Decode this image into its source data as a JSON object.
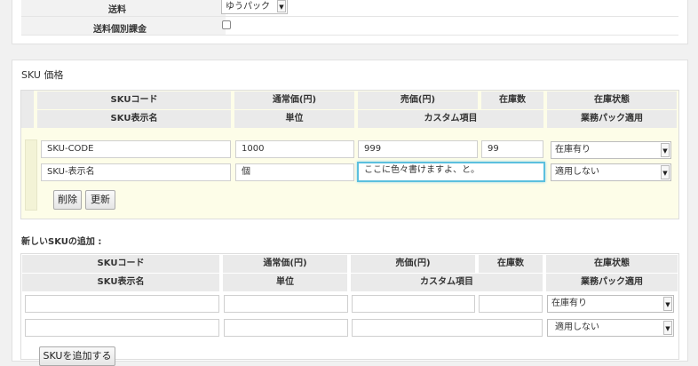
{
  "shipping": {
    "fee_label": "送料",
    "fee_select": "ゆうパック",
    "individual_label": "送料個別課金"
  },
  "sku_price": {
    "title": "SKU 価格",
    "headers_row1": [
      "SKUコード",
      "通常価(円)",
      "売価(円)",
      "在庫数",
      "在庫状態"
    ],
    "headers_row2": [
      "SKU表示名",
      "単位",
      "カスタム項目",
      "業務パック適用"
    ],
    "row": {
      "code": "SKU-CODE",
      "regular_price": "1000",
      "sale_price": "999",
      "stock": "99",
      "stock_status": "在庫有り",
      "display_name": "SKU-表示名",
      "unit": "個",
      "custom": "ここに色々書けますよ、と。",
      "pack": "適用しない"
    },
    "delete_button": "削除",
    "update_button": "更新"
  },
  "new_sku": {
    "title": "新しいSKUの追加 :",
    "headers_row1": [
      "SKUコード",
      "通常価(円)",
      "売価(円)",
      "在庫数",
      "在庫状態"
    ],
    "headers_row2": [
      "SKU表示名",
      "単位",
      "カスタム項目",
      "業務パック適用"
    ],
    "stock_status": "在庫有り",
    "pack": "適用しない",
    "add_button": "SKUを追加する"
  }
}
